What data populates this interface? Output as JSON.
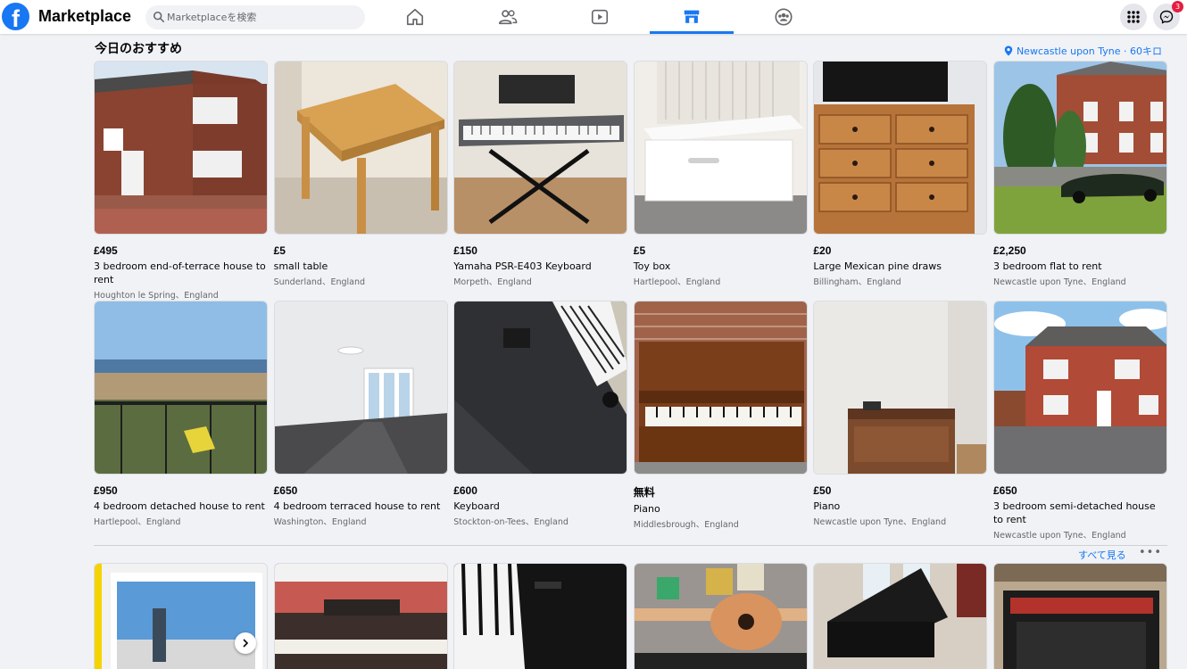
{
  "app": {
    "title": "Marketplace",
    "logo_letter": "f"
  },
  "search": {
    "placeholder": "Marketplaceを検索"
  },
  "nav": [
    "home-icon",
    "friends-icon",
    "watch-icon",
    "marketplace-icon",
    "groups-icon"
  ],
  "messenger_badge": "3",
  "section": {
    "title": "今日のおすすめ",
    "location": "Newcastle upon Tyne · 60キロ"
  },
  "listings": [
    {
      "price": "£495",
      "name": "3 bedroom end-of-terrace house to rent",
      "location": "Houghton le Spring、England"
    },
    {
      "price": "£5",
      "name": "small table",
      "location": "Sunderland、England"
    },
    {
      "price": "£150",
      "name": "Yamaha PSR-E403 Keyboard",
      "location": "Morpeth、England"
    },
    {
      "price": "£5",
      "name": "Toy box",
      "location": "Hartlepool、England"
    },
    {
      "price": "£20",
      "name": "Large Mexican pine draws",
      "location": "Billingham、England"
    },
    {
      "price": "£2,250",
      "name": "3 bedroom flat to rent",
      "location": "Newcastle upon Tyne、England"
    },
    {
      "price": "£950",
      "name": "4 bedroom detached house to rent",
      "location": "Hartlepool、England"
    },
    {
      "price": "£650",
      "name": "4 bedroom terraced house to rent",
      "location": "Washington、England"
    },
    {
      "price": "£600",
      "name": "Keyboard",
      "location": "Stockton-on-Tees、England"
    },
    {
      "price": "無料",
      "name": "Piano",
      "location": "Middlesbrough、England"
    },
    {
      "price": "£50",
      "name": "Piano",
      "location": "Newcastle upon Tyne、England"
    },
    {
      "price": "£650",
      "name": "3 bedroom semi-detached house to rent",
      "location": "Newcastle upon Tyne、England"
    }
  ],
  "footer_row": {
    "see_all": "すべて見る",
    "more": "•••"
  },
  "colors": {
    "accent": "#1877f2",
    "background": "#f0f2f5",
    "badge": "#e41e3f"
  }
}
